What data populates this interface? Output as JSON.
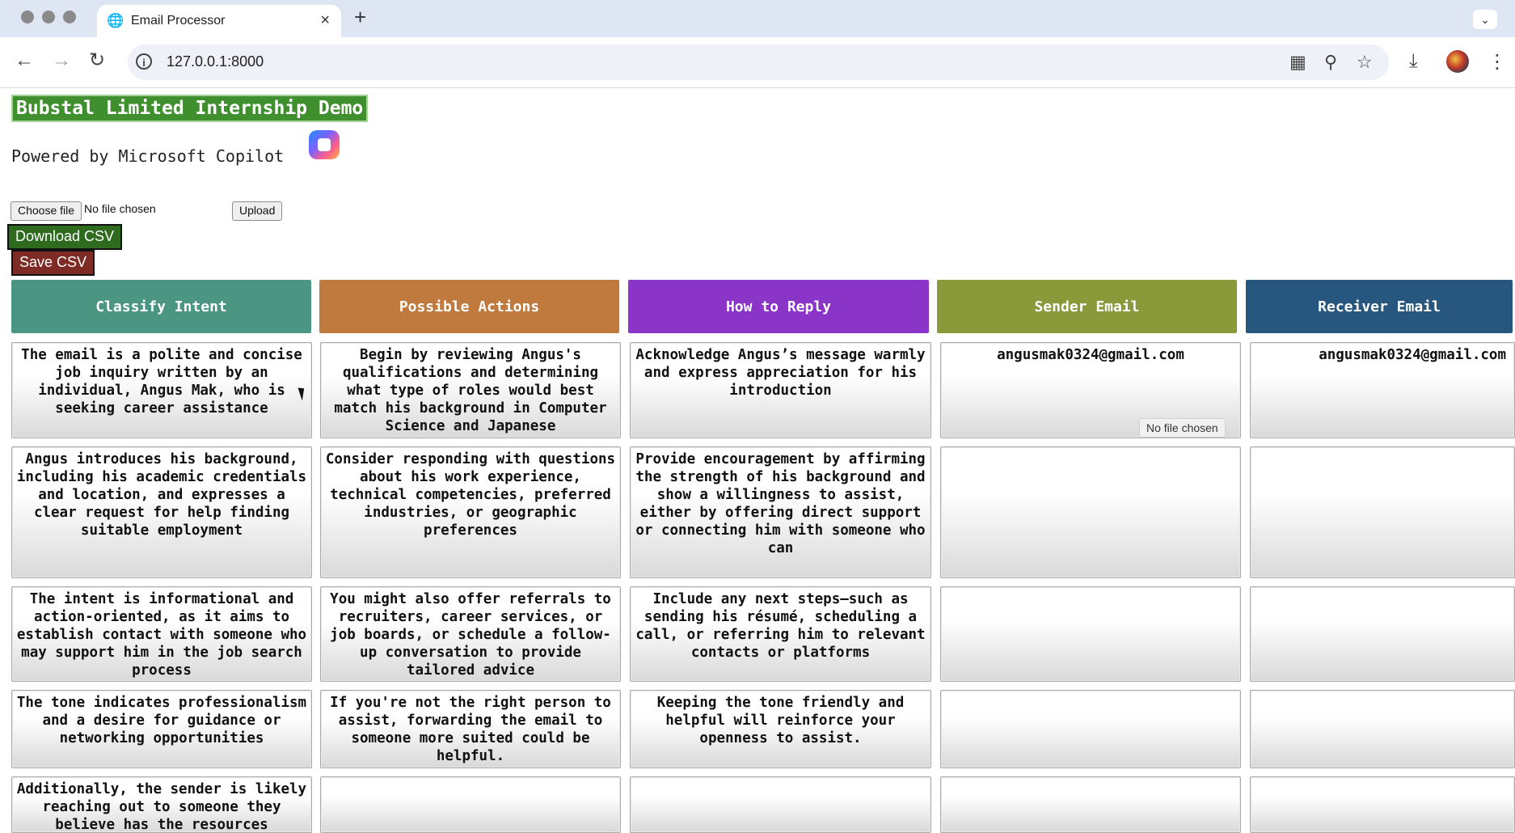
{
  "browser": {
    "tab_title": "Email Processor",
    "url": "127.0.0.1:8000",
    "new_tab_symbol": "+",
    "close_symbol": "×"
  },
  "page": {
    "banner": "Bubstal Limited Internship Demo",
    "powered_by": "Powered by Microsoft Copilot",
    "file_input": {
      "button_label": "Choose file",
      "status": "No file chosen"
    },
    "upload_label": "Upload",
    "download_label": "Download CSV",
    "save_label": "Save CSV",
    "tooltip": "No file chosen"
  },
  "table": {
    "headers": [
      {
        "label": "Classify Intent",
        "color": "#4a9683"
      },
      {
        "label": "Possible Actions",
        "color": "#c07a3e"
      },
      {
        "label": "How to Reply",
        "color": "#8a35c8"
      },
      {
        "label": "Sender Email",
        "color": "#8a9a3a"
      },
      {
        "label": "Receiver Email",
        "color": "#27577f"
      }
    ],
    "rows": [
      {
        "classify": "The email is a polite and concise job inquiry written by an individual, Angus Mak, who is seeking career assistance",
        "actions": "Begin by reviewing Angus's qualifications and determining what type of roles would best match his background in Computer Science and Japanese",
        "reply": "Acknowledge Angus’s message warmly and express appreciation for his introduction",
        "sender": "angusmak0324@gmail.com",
        "receiver": "angusmak0324@gmail.com"
      },
      {
        "classify": "Angus introduces his background, including his academic credentials and location, and expresses a clear request for help finding suitable employment",
        "actions": "Consider responding with questions about his work experience, technical competencies, preferred industries, or geographic preferences",
        "reply": "Provide encouragement by affirming the strength of his background and show a willingness to assist, either by offering direct support or connecting him with someone who can",
        "sender": "",
        "receiver": ""
      },
      {
        "classify": "The intent is informational and action-oriented, as it aims to establish contact with someone who may support him in the job search process",
        "actions": "You might also offer referrals to recruiters, career services, or job boards, or schedule a follow-up conversation to provide tailored advice",
        "reply": "Include any next steps—such as sending his résumé, scheduling a call, or referring him to relevant contacts or platforms",
        "sender": "",
        "receiver": ""
      },
      {
        "classify": "The tone indicates professionalism and a desire for guidance or networking opportunities",
        "actions": "If you're not the right person to assist, forwarding the email to someone more suited could be helpful.",
        "reply": "Keeping the tone friendly and helpful will reinforce your openness to assist.",
        "sender": "",
        "receiver": ""
      },
      {
        "classify": "Additionally, the sender is likely reaching out to someone they believe has the resources",
        "actions": "",
        "reply": "",
        "sender": "",
        "receiver": ""
      }
    ]
  }
}
